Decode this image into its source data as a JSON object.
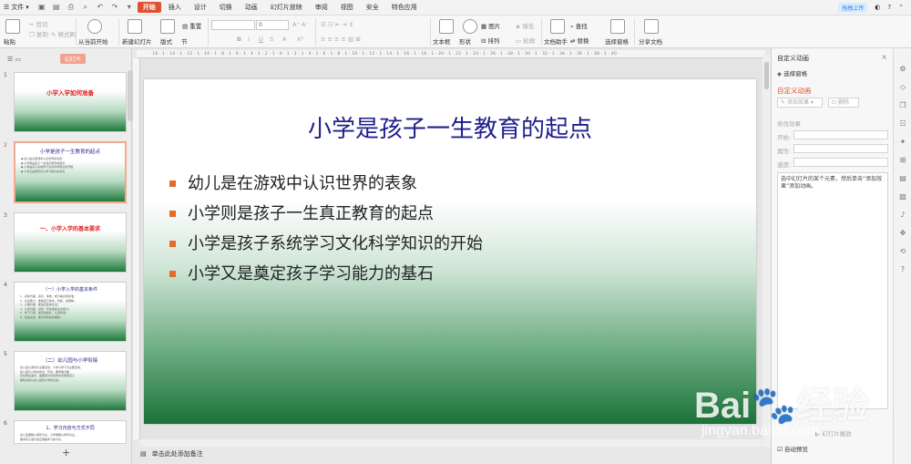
{
  "menubar": {
    "file_label": "文件",
    "tabs": [
      "开始",
      "插入",
      "设计",
      "切换",
      "动画",
      "幻灯片放映",
      "审阅",
      "视图",
      "安全",
      "特色应用"
    ],
    "active_tab": "开始",
    "cloud_label": "拖拽上传"
  },
  "toolbar": {
    "paste": "粘贴",
    "cut": "剪切",
    "copy": "复制",
    "format_painter": "格式刷",
    "play_from_current": "从当前开始",
    "new_slide": "新建幻灯片",
    "layout": "版式",
    "section": "节",
    "reset": "重置",
    "font_size_value": "0",
    "text_box": "文本框",
    "shape": "形状",
    "arrange": "排列",
    "picture": "图片",
    "fill": "填充",
    "outline": "轮廓",
    "doc_assistant": "文档助手",
    "find": "查找",
    "replace": "替换",
    "select_pane": "选择窗格",
    "share_doc": "分享文档"
  },
  "left_panel": {
    "tab_label": "幻灯片",
    "add_slide_symbol": "+",
    "thumbnails": [
      {
        "num": "1",
        "title": "小学入学如何准备",
        "lines": []
      },
      {
        "num": "2",
        "title": "小学是孩子一生教育的起点",
        "lines": [
          "◆ 幼儿是在游戏中认识世界的表象",
          "◆ 小学则是孩子一生真正教育的起点",
          "◆ 小学是孩子系统学习文化科学知识的开始",
          "◆ 小学又是奠定孩子学习能力的基石"
        ]
      },
      {
        "num": "3",
        "title": "一、小学入学的基本要求",
        "lines": []
      },
      {
        "num": "4",
        "title": "（一）小学入学的基本条件",
        "lines": [
          "1、身体方面：身高、体重、视力等达到标准；",
          "2、生活能力：能够自己穿衣、吃饭、如厕等；",
          "3、心理方面：能适应集体生活；",
          "4、认知方面：具有一定的语言表达能力；",
          "5、学习习惯：能安静坐好、认真听讲；",
          "6、社会交往：能与同伴友好相处。"
        ]
      },
      {
        "num": "5",
        "title": "（二）幼儿园与小学衔接",
        "lines": [
          "幼儿园以游戏为主要活动，小学以学习为主要活动，",
          "幼儿园与小学在作息、环境、要求等方面",
          "存在明显差异，需要家长和老师共同帮助孩子",
          "顺利完成从幼儿园到小学的过渡。"
        ]
      },
      {
        "num": "6",
        "title": "1、学习内容与方式不同",
        "lines": [
          "幼儿园课程以游戏为主，小学课程以学科为主，",
          "要求孩子逐步适应课堂学习的方式。"
        ]
      }
    ]
  },
  "slide": {
    "title": "小学是孩子一生教育的起点",
    "bullets": [
      "幼儿是在游戏中认识世界的表象",
      "小学则是孩子一生真正教育的起点",
      "小学是孩子系统学习文化科学知识的开始",
      "小学又是奠定孩子学习能力的基石"
    ]
  },
  "notes_placeholder": "单击此处添加备注",
  "right_panel": {
    "title": "自定义动画",
    "select_pane": "选择窗格",
    "custom_anim": "自定义动画",
    "add_effect": "添加效果",
    "delete": "删除",
    "modify_effect": "修改效果",
    "start_label": "开始:",
    "property_label": "属性:",
    "speed_label": "速度:",
    "hint": "选中幻灯片的某个元素，然后单击“添加效果”添加动画。",
    "slideshow_label": "幻灯片播放",
    "auto_preview": "自动预览"
  },
  "watermark": {
    "brand": "Bai",
    "brand2": "经验",
    "url": "jingyan.baidu.com"
  }
}
